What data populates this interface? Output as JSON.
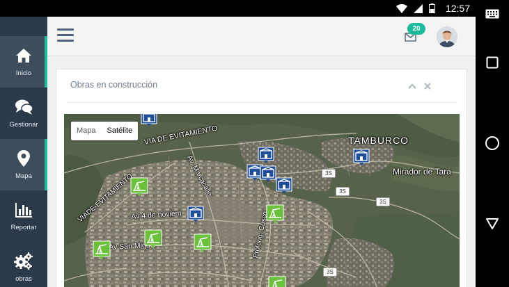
{
  "status_bar": {
    "time": "12:57"
  },
  "sidebar": {
    "items": [
      {
        "label": "Inicio",
        "icon": "home-icon",
        "active": true
      },
      {
        "label": "Gestionar",
        "icon": "chat-icon",
        "active": false
      },
      {
        "label": "Mapa",
        "icon": "map-pin-icon",
        "active": true
      },
      {
        "label": "Reportar",
        "icon": "bar-chart-icon",
        "active": false
      },
      {
        "label": "obras",
        "icon": "gears-icon",
        "active": false
      }
    ]
  },
  "header": {
    "notifications_count": "20"
  },
  "panel": {
    "title": "Obras en construcción"
  },
  "map": {
    "type_buttons": {
      "map": "Mapa",
      "satellite": "Satélite"
    },
    "labels": {
      "tamburco": "TAMBURCO",
      "mirador": "Mirador de Tara",
      "via_evitamiento": "VIA DE EVITAMIENTO",
      "viade_evitamiento": "VIADE-EVITAMIENTO",
      "av_marcacalle": "Av. Marcacalle",
      "av_4_noviembre": "Av 4 de noviem",
      "av_san_miguel": "Av San Miguel",
      "prolong_cusco": "Prolong. Cusco"
    },
    "route_shields": [
      "3S",
      "3S",
      "3S",
      "3S"
    ]
  },
  "colors": {
    "sidebar_bg": "#2b3a48",
    "accent": "#1abc9c",
    "panel_title": "#6a7f94",
    "marker_blue": "#1f4f9a",
    "marker_green": "#6ac13a"
  }
}
